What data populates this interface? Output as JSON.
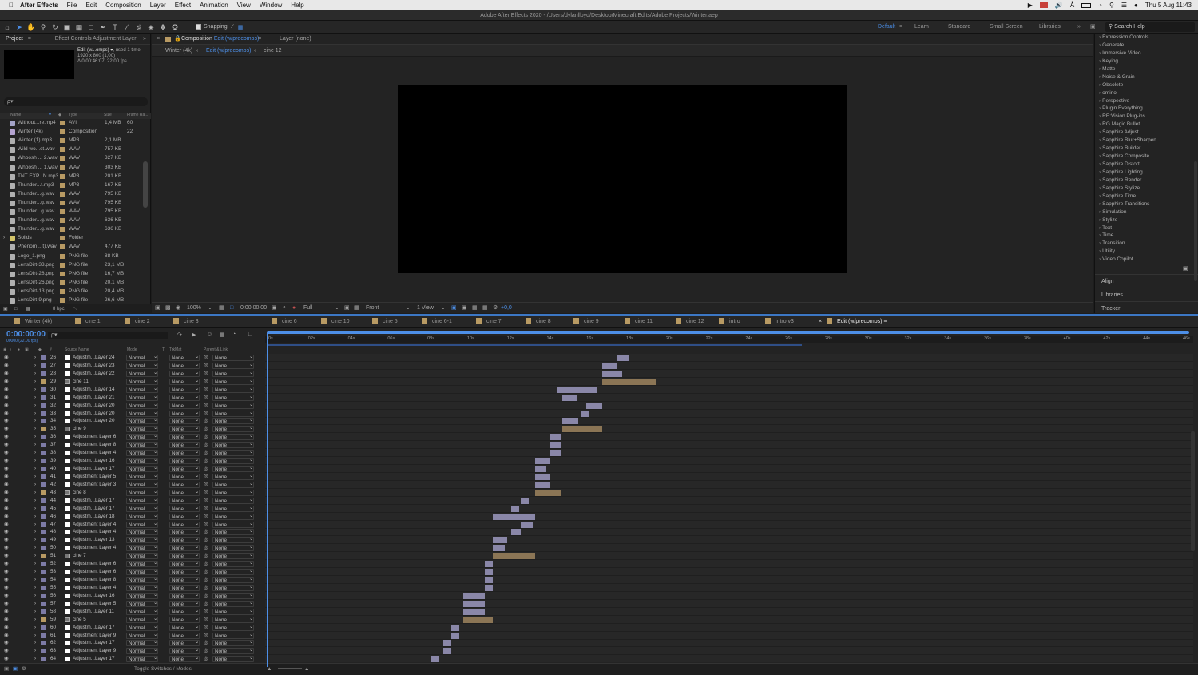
{
  "menubar": {
    "apple_icon": "apple-icon",
    "app": "After Effects",
    "items": [
      "File",
      "Edit",
      "Composition",
      "Layer",
      "Effect",
      "Animation",
      "View",
      "Window",
      "Help"
    ],
    "clock": "Thu 5 Aug  11:43"
  },
  "titlebar": {
    "title": "Adobe After Effects 2020 - /Users/dylanlloyd/Desktop/Minecraft Edits/Adobe Projects/Winter.aep"
  },
  "toolbar": {
    "snapping": "Snapping",
    "workspaces": [
      "Default",
      "Learn",
      "Standard",
      "Small Screen",
      "Libraries"
    ],
    "search_placeholder": "Search Help"
  },
  "project": {
    "tab": "Project",
    "effect_controls": "Effect Controls Adjustment Layer",
    "comp_name": "Edit (w...omps) ▾",
    "used": ", used 1 time",
    "size": "1920 x 800 (1,00)",
    "duration": "Δ 0:00:46:07, 22,00 fps",
    "search_placeholder": "ρ▾",
    "headers": [
      "Name",
      "Type",
      "Size",
      "Frame Ra..."
    ],
    "bpc": "8 bpc",
    "items": [
      {
        "name": "Without...re.mp4",
        "type": "AVI",
        "size": "1,4 MB",
        "fr": "60",
        "color": "#a3a3c7"
      },
      {
        "name": "Winter (4k)",
        "type": "Composition",
        "size": "",
        "fr": "22",
        "color": "#b5a4d1"
      },
      {
        "name": "Winter (1).mp3",
        "type": "MP3",
        "size": "2,1 MB",
        "fr": "",
        "color": "#b0b0b0"
      },
      {
        "name": "Wild wo...ct.wav",
        "type": "WAV",
        "size": "757 KB",
        "fr": "",
        "color": "#b0b0b0"
      },
      {
        "name": "Whoosh ... 2.wav",
        "type": "WAV",
        "size": "327 KB",
        "fr": "",
        "color": "#b0b0b0"
      },
      {
        "name": "Whoosh ... 1.wav",
        "type": "WAV",
        "size": "303 KB",
        "fr": "",
        "color": "#b0b0b0"
      },
      {
        "name": "TNT EXP...N.mp3",
        "type": "MP3",
        "size": "201 KB",
        "fr": "",
        "color": "#b0b0b0"
      },
      {
        "name": "Thunder...t.mp3",
        "type": "MP3",
        "size": "167 KB",
        "fr": "",
        "color": "#b0b0b0"
      },
      {
        "name": "Thunder...g.wav",
        "type": "WAV",
        "size": "795 KB",
        "fr": "",
        "color": "#b0b0b0"
      },
      {
        "name": "Thunder...g.wav",
        "type": "WAV",
        "size": "795 KB",
        "fr": "",
        "color": "#b0b0b0"
      },
      {
        "name": "Thunder...g.wav",
        "type": "WAV",
        "size": "795 KB",
        "fr": "",
        "color": "#b0b0b0"
      },
      {
        "name": "Thunder...g.wav",
        "type": "WAV",
        "size": "636 KB",
        "fr": "",
        "color": "#b0b0b0"
      },
      {
        "name": "Thunder...g.wav",
        "type": "WAV",
        "size": "636 KB",
        "fr": "",
        "color": "#b0b0b0"
      },
      {
        "name": "Solids",
        "type": "Folder",
        "size": "",
        "fr": "",
        "color": "#d3c46a"
      },
      {
        "name": "Phenom ...t).wav",
        "type": "WAV",
        "size": "477 KB",
        "fr": "",
        "color": "#b0b0b0"
      },
      {
        "name": "Logo_1.png",
        "type": "PNG file",
        "size": "88 KB",
        "fr": "",
        "color": "#b0b0b0"
      },
      {
        "name": "LensDirt-33.png",
        "type": "PNG file",
        "size": "23,1 MB",
        "fr": "",
        "color": "#b0b0b0"
      },
      {
        "name": "LensDirt-28.png",
        "type": "PNG file",
        "size": "16,7 MB",
        "fr": "",
        "color": "#b0b0b0"
      },
      {
        "name": "LensDirt-26.png",
        "type": "PNG file",
        "size": "20,1 MB",
        "fr": "",
        "color": "#b0b0b0"
      },
      {
        "name": "LensDirt-13.png",
        "type": "PNG file",
        "size": "20,4 MB",
        "fr": "",
        "color": "#b0b0b0"
      },
      {
        "name": "LensDirt-9.png",
        "type": "PNG file",
        "size": "26,6 MB",
        "fr": "",
        "color": "#b0b0b0"
      }
    ]
  },
  "viewer": {
    "comp_tab": "Composition",
    "comp_name": "Edit (w/precomps)",
    "layer_tab": "Layer (none)",
    "breadcrumbs": [
      "Winter (4k)",
      "Edit (w/precomps)",
      "cine 12"
    ],
    "zoom": "100%",
    "time": "0:00:00:00",
    "resolution": "Full",
    "camera": "Front",
    "views": "1 View",
    "exposure": "+0,0"
  },
  "effects": {
    "items": [
      "Expression Controls",
      "Generate",
      "Immersive Video",
      "Keying",
      "Matte",
      "Noise & Grain",
      "Obsolete",
      "omino",
      "Perspective",
      "Plugin Everything",
      "RE:Vision Plug-ins",
      "RG Magic Bullet",
      "Sapphire Adjust",
      "Sapphire Blur+Sharpen",
      "Sapphire Builder",
      "Sapphire Composite",
      "Sapphire Distort",
      "Sapphire Lighting",
      "Sapphire Render",
      "Sapphire Stylize",
      "Sapphire Time",
      "Sapphire Transitions",
      "Simulation",
      "Stylize",
      "Text",
      "Time",
      "Transition",
      "Utility",
      "Video Copilot"
    ],
    "panels": [
      "Align",
      "Libraries",
      "Tracker"
    ]
  },
  "timeline": {
    "tabs": [
      "Winter (4k)",
      "cine 1",
      "cine 2",
      "cine 3",
      "cine 6",
      "cine 10",
      "cine 5",
      "cine 6-1",
      "cine 7",
      "cine 8",
      "cine 9",
      "cine 11",
      "cine 12",
      "intro",
      "intro v3",
      "Edit (w/precomps)"
    ],
    "timecode": "0:00:00:00",
    "timecode_sub": "00000 (22.00 fps)",
    "search_placeholder": "ρ▾",
    "columns": [
      "#",
      "Source Name",
      "Mode",
      "T",
      "TrkMat",
      "Parent & Link"
    ],
    "ruler": [
      "0s",
      "02s",
      "04s",
      "06s",
      "08s",
      "10s",
      "12s",
      "14s",
      "16s",
      "18s",
      "20s",
      "22s",
      "24s",
      "26s",
      "28s",
      "30s",
      "32s",
      "34s",
      "36s",
      "38s",
      "40s",
      "42s",
      "44s",
      "46s"
    ],
    "toggle_label": "Toggle Switches / Modes",
    "layers": [
      {
        "n": "26",
        "name": "Adjustm...Layer 24",
        "mode": "Normal",
        "trk": "None",
        "parent": "None",
        "pc": false,
        "start": 17.5,
        "end": 18.1
      },
      {
        "n": "27",
        "name": "Adjustm...Layer 23",
        "mode": "Normal",
        "trk": "None",
        "parent": "None",
        "pc": false,
        "start": 16.8,
        "end": 17.5
      },
      {
        "n": "28",
        "name": "Adjustm...Layer 22",
        "mode": "Normal",
        "trk": "None",
        "parent": "None",
        "pc": false,
        "start": 16.8,
        "end": 17.8
      },
      {
        "n": "29",
        "name": "cine 11",
        "mode": "Normal",
        "trk": "None",
        "parent": "None",
        "pc": true,
        "start": 16.8,
        "end": 19.5
      },
      {
        "n": "30",
        "name": "Adjustm...Layer 14",
        "mode": "Normal",
        "trk": "None",
        "parent": "None",
        "pc": false,
        "start": 14.5,
        "end": 16.5
      },
      {
        "n": "31",
        "name": "Adjustm...Layer 21",
        "mode": "Normal",
        "trk": "None",
        "parent": "None",
        "pc": false,
        "start": 14.8,
        "end": 15.5
      },
      {
        "n": "32",
        "name": "Adjustm...Layer 20",
        "mode": "Normal",
        "trk": "None",
        "parent": "None",
        "pc": false,
        "start": 16.0,
        "end": 16.8
      },
      {
        "n": "33",
        "name": "Adjustm...Layer 20",
        "mode": "Normal",
        "trk": "None",
        "parent": "None",
        "pc": false,
        "start": 15.7,
        "end": 16.1
      },
      {
        "n": "34",
        "name": "Adjustm...Layer 20",
        "mode": "Normal",
        "trk": "None",
        "parent": "None",
        "pc": false,
        "start": 14.8,
        "end": 15.6
      },
      {
        "n": "35",
        "name": "cine 9",
        "mode": "Normal",
        "trk": "None",
        "parent": "None",
        "pc": true,
        "start": 14.8,
        "end": 16.8
      },
      {
        "n": "36",
        "name": "Adjustment Layer 6",
        "mode": "Normal",
        "trk": "None",
        "parent": "None",
        "pc": false,
        "start": 14.2,
        "end": 14.7
      },
      {
        "n": "37",
        "name": "Adjustment Layer 8",
        "mode": "Normal",
        "trk": "None",
        "parent": "None",
        "pc": false,
        "start": 14.2,
        "end": 14.7
      },
      {
        "n": "38",
        "name": "Adjustment Layer 4",
        "mode": "Normal",
        "trk": "None",
        "parent": "None",
        "pc": false,
        "start": 14.2,
        "end": 14.7
      },
      {
        "n": "39",
        "name": "Adjustm...Layer 16",
        "mode": "Normal",
        "trk": "None",
        "parent": "None",
        "pc": false,
        "start": 13.4,
        "end": 14.2
      },
      {
        "n": "40",
        "name": "Adjustm...Layer 17",
        "mode": "Normal",
        "trk": "None",
        "parent": "None",
        "pc": false,
        "start": 13.4,
        "end": 14.0
      },
      {
        "n": "41",
        "name": "Adjustment Layer 5",
        "mode": "Normal",
        "trk": "None",
        "parent": "None",
        "pc": false,
        "start": 13.4,
        "end": 14.2
      },
      {
        "n": "42",
        "name": "Adjustment Layer 3",
        "mode": "Normal",
        "trk": "None",
        "parent": "None",
        "pc": false,
        "start": 13.4,
        "end": 14.2
      },
      {
        "n": "43",
        "name": "cine 8",
        "mode": "Normal",
        "trk": "None",
        "parent": "None",
        "pc": true,
        "start": 13.4,
        "end": 14.7
      },
      {
        "n": "44",
        "name": "Adjustm...Layer 17",
        "mode": "Normal",
        "trk": "None",
        "parent": "None",
        "pc": false,
        "start": 12.7,
        "end": 13.1
      },
      {
        "n": "45",
        "name": "Adjustm...Layer 17",
        "mode": "Normal",
        "trk": "None",
        "parent": "None",
        "pc": false,
        "start": 12.2,
        "end": 12.6
      },
      {
        "n": "46",
        "name": "Adjustm...Layer 18",
        "mode": "Normal",
        "trk": "None",
        "parent": "None",
        "pc": false,
        "start": 11.3,
        "end": 13.4
      },
      {
        "n": "47",
        "name": "Adjustment Layer 4",
        "mode": "Normal",
        "trk": "None",
        "parent": "None",
        "pc": false,
        "start": 12.7,
        "end": 13.3
      },
      {
        "n": "48",
        "name": "Adjustment Layer 4",
        "mode": "Normal",
        "trk": "None",
        "parent": "None",
        "pc": false,
        "start": 12.2,
        "end": 12.7
      },
      {
        "n": "49",
        "name": "Adjustm...Layer 13",
        "mode": "Normal",
        "trk": "None",
        "parent": "None",
        "pc": false,
        "start": 11.3,
        "end": 12.0
      },
      {
        "n": "50",
        "name": "Adjustment Layer 4",
        "mode": "Normal",
        "trk": "None",
        "parent": "None",
        "pc": false,
        "start": 11.3,
        "end": 11.9
      },
      {
        "n": "51",
        "name": "cine 7",
        "mode": "Normal",
        "trk": "None",
        "parent": "None",
        "pc": true,
        "start": 11.3,
        "end": 13.4
      },
      {
        "n": "52",
        "name": "Adjustment Layer 6",
        "mode": "Normal",
        "trk": "None",
        "parent": "None",
        "pc": false,
        "start": 10.9,
        "end": 11.3
      },
      {
        "n": "53",
        "name": "Adjustment Layer 6",
        "mode": "Normal",
        "trk": "None",
        "parent": "None",
        "pc": false,
        "start": 10.9,
        "end": 11.3
      },
      {
        "n": "54",
        "name": "Adjustment Layer 8",
        "mode": "Normal",
        "trk": "None",
        "parent": "None",
        "pc": false,
        "start": 10.9,
        "end": 11.3
      },
      {
        "n": "55",
        "name": "Adjustment Layer 4",
        "mode": "Normal",
        "trk": "None",
        "parent": "None",
        "pc": false,
        "start": 10.9,
        "end": 11.3
      },
      {
        "n": "56",
        "name": "Adjustm...Layer 16",
        "mode": "Normal",
        "trk": "None",
        "parent": "None",
        "pc": false,
        "start": 9.8,
        "end": 10.9
      },
      {
        "n": "57",
        "name": "Adjustment Layer 5",
        "mode": "Normal",
        "trk": "None",
        "parent": "None",
        "pc": false,
        "start": 9.8,
        "end": 10.9
      },
      {
        "n": "58",
        "name": "Adjustm...Layer 11",
        "mode": "Normal",
        "trk": "None",
        "parent": "None",
        "pc": false,
        "start": 9.8,
        "end": 10.9
      },
      {
        "n": "59",
        "name": "cine 5",
        "mode": "Normal",
        "trk": "None",
        "parent": "None",
        "pc": true,
        "start": 9.8,
        "end": 11.3
      },
      {
        "n": "60",
        "name": "Adjustm...Layer 17",
        "mode": "Normal",
        "trk": "None",
        "parent": "None",
        "pc": false,
        "start": 9.2,
        "end": 9.6
      },
      {
        "n": "61",
        "name": "Adjustment Layer 9",
        "mode": "Normal",
        "trk": "None",
        "parent": "None",
        "pc": false,
        "start": 9.2,
        "end": 9.6
      },
      {
        "n": "62",
        "name": "Adjustm...Layer 17",
        "mode": "Normal",
        "trk": "None",
        "parent": "None",
        "pc": false,
        "start": 8.8,
        "end": 9.2
      },
      {
        "n": "63",
        "name": "Adjustment Layer 9",
        "mode": "Normal",
        "trk": "None",
        "parent": "None",
        "pc": false,
        "start": 8.8,
        "end": 9.2
      },
      {
        "n": "64",
        "name": "Adjustm...Layer 17",
        "mode": "Normal",
        "trk": "None",
        "parent": "None",
        "pc": false,
        "start": 8.2,
        "end": 8.6
      }
    ]
  },
  "colors": {
    "accent": "#4d8fe7",
    "adjustment_bar": "#8a87a8",
    "precomp_bar": "#8b7555",
    "tab_label": "#b89a63"
  }
}
